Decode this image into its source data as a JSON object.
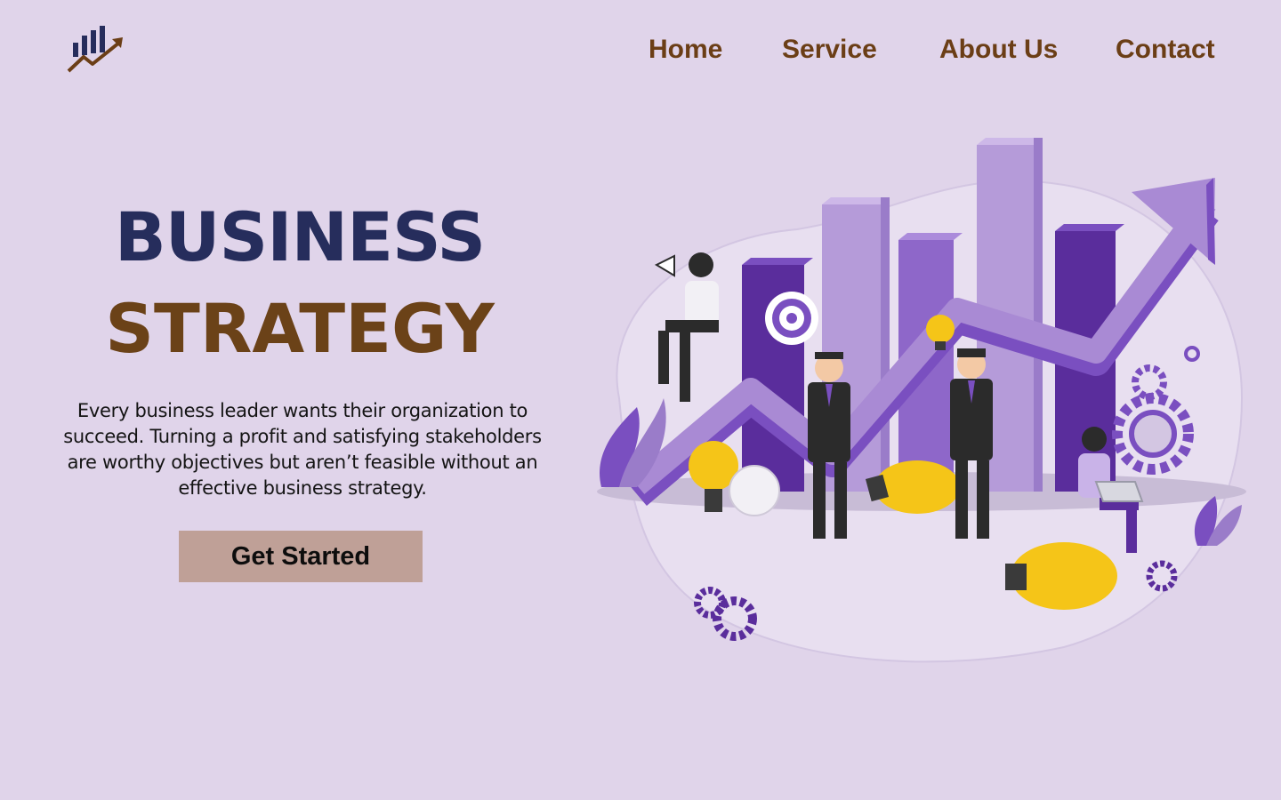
{
  "header": {
    "logo_icon": "growth-chart-logo-icon",
    "nav": [
      {
        "label": "Home"
      },
      {
        "label": "Service"
      },
      {
        "label": "About Us"
      },
      {
        "label": "Contact"
      }
    ]
  },
  "hero": {
    "title_line1": "BUSINESS",
    "title_line2": "STRATEGY",
    "description": "Every business leader wants their organization to succeed. Turning a profit and satisfying stakeholders are worthy objectives but aren’t feasible without an effective business strategy.",
    "cta_label": "Get Started"
  },
  "illustration": {
    "icon": "business-growth-illustration"
  },
  "colors": {
    "background": "#e0d4ea",
    "nav_text": "#6b3e16",
    "title_navy": "#262d5c",
    "title_brown": "#6b4218",
    "button_bg": "#bfa097",
    "purple_dark": "#5a2d9c",
    "purple_light": "#a98ad4",
    "bulb_yellow": "#f5c518"
  }
}
